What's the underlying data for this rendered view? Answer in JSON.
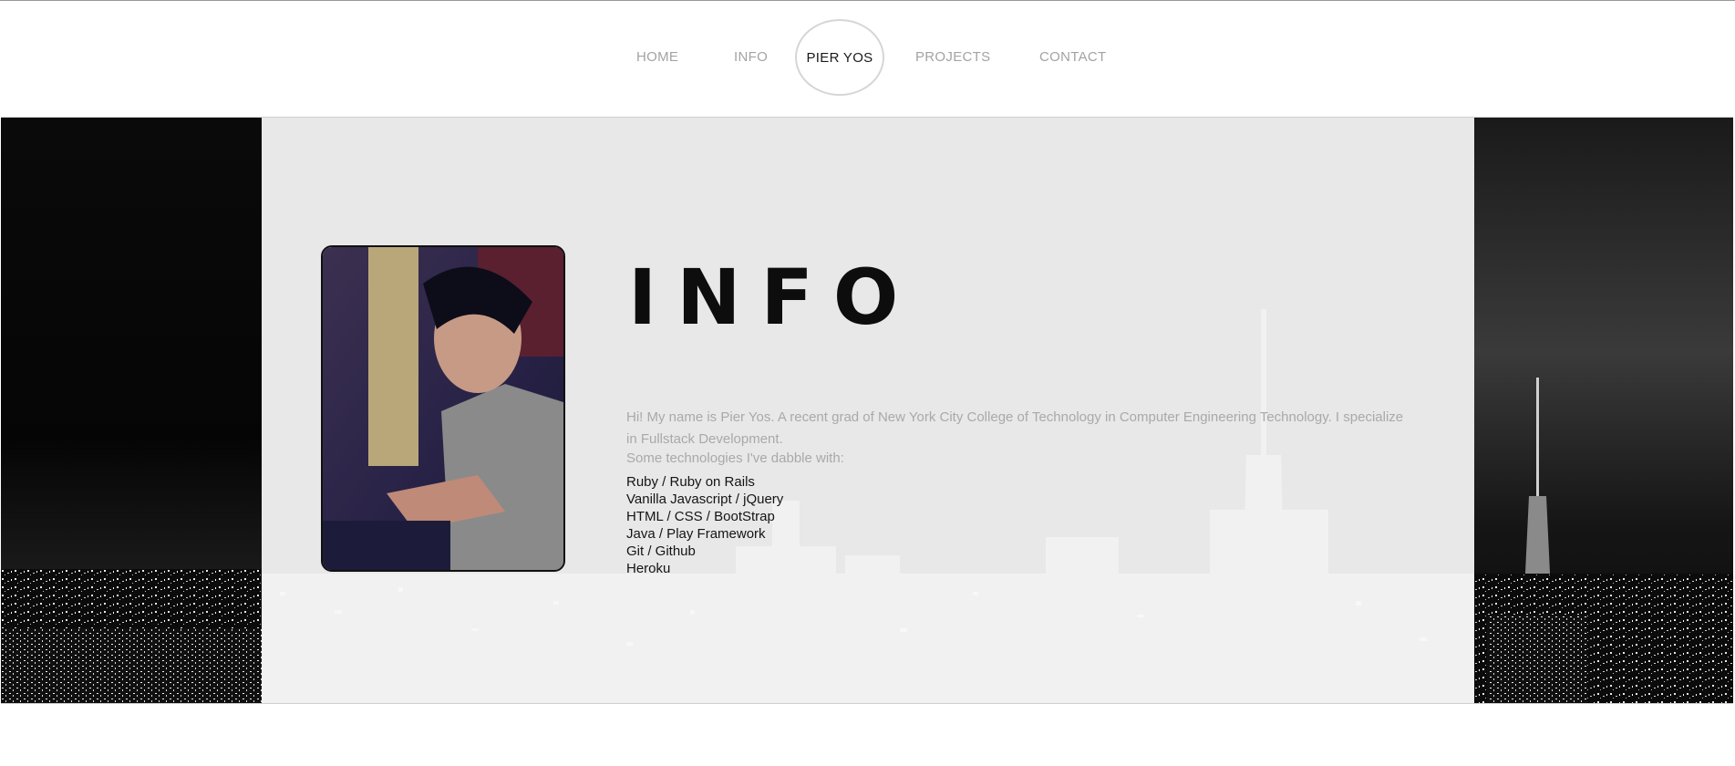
{
  "nav": {
    "home": "HOME",
    "info": "INFO",
    "brand": "PIER YOS",
    "projects": "PROJECTS",
    "contact": "CONTACT"
  },
  "section": {
    "title": "INFO",
    "bio": "Hi! My name is Pier Yos. A recent grad of New York City College of Technology in Computer Engineering Technology. I specialize in Fullstack Development.",
    "tech_intro": "Some technologies I've dabble with:",
    "technologies": [
      "Ruby / Ruby on Rails",
      "Vanilla Javascript / jQuery",
      "HTML / CSS / BootStrap",
      "Java / Play Framework",
      "Git / Github",
      "Heroku"
    ]
  },
  "colors": {
    "panel": "#e8e8e8",
    "nav_text": "#a3a3a3",
    "brand_ring": "#d6d6d6"
  }
}
